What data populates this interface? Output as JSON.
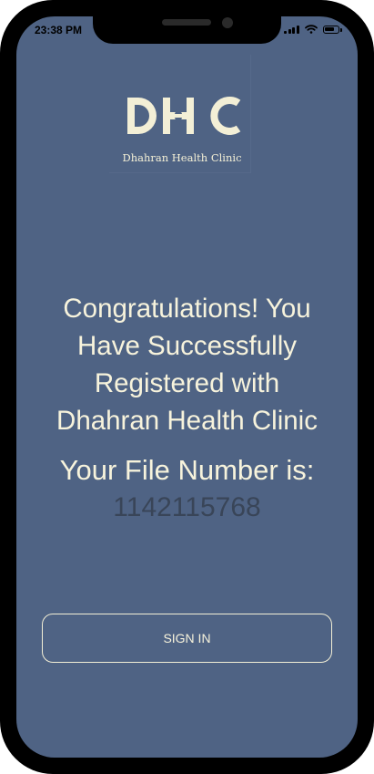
{
  "status_bar": {
    "time": "23:38 PM",
    "battery_level": 0.8
  },
  "logo": {
    "mark_text": "DHC",
    "subtitle": "Dhahran Health Clinic"
  },
  "message": {
    "lines": [
      "Congratulations! You",
      "Have Successfully",
      "Registered with",
      "Dhahran Health Clinic"
    ]
  },
  "file": {
    "label": "Your File Number is:",
    "number": "1142115768"
  },
  "actions": {
    "sign_in_label": "SIGN IN"
  },
  "colors": {
    "background": "#4f6384",
    "accent_text": "#f7f3dc",
    "file_number": "#394558",
    "frame": "#000000"
  }
}
